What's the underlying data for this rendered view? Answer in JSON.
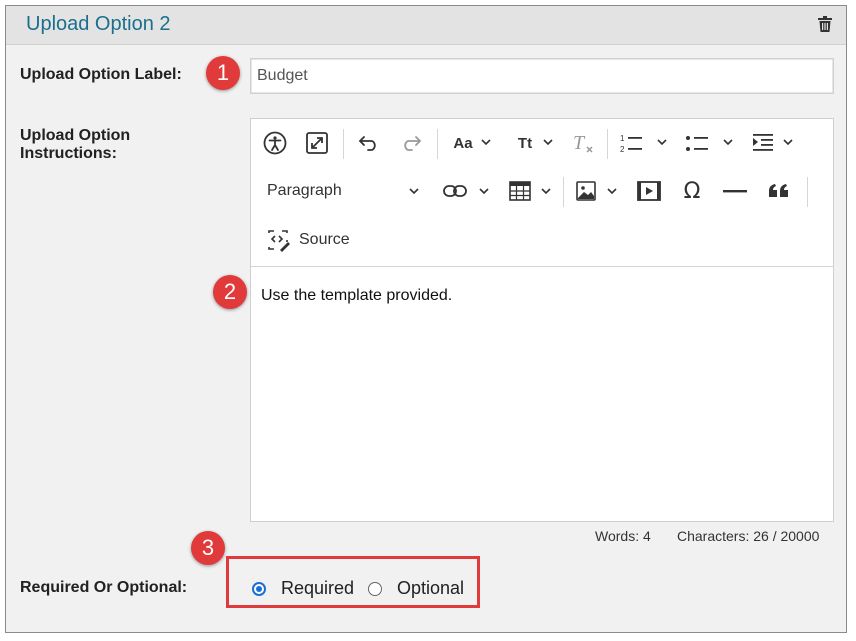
{
  "header": {
    "title": "Upload Option 2",
    "delete_icon": "trash-icon"
  },
  "label_field": {
    "label": "Upload Option Label:",
    "value": "Budget"
  },
  "instructions": {
    "label_line1": "Upload Option",
    "label_line2": "Instructions:",
    "toolbar": {
      "paragraph_label": "Paragraph",
      "source_label": "Source",
      "font_size_label": "Aa",
      "text_style_label": "Tt"
    },
    "content": "Use the template provided.",
    "words": "Words: 4",
    "characters": "Characters: 26 / 20000"
  },
  "required": {
    "label": "Required Or Optional:",
    "options": [
      "Required",
      "Optional"
    ],
    "selected": "Required"
  },
  "annotations": {
    "badge1": "1",
    "badge2": "2",
    "badge3": "3"
  },
  "colors": {
    "accent": "#1a6f8c",
    "radio": "#1a6fd6",
    "callout": "#e03a3a"
  }
}
